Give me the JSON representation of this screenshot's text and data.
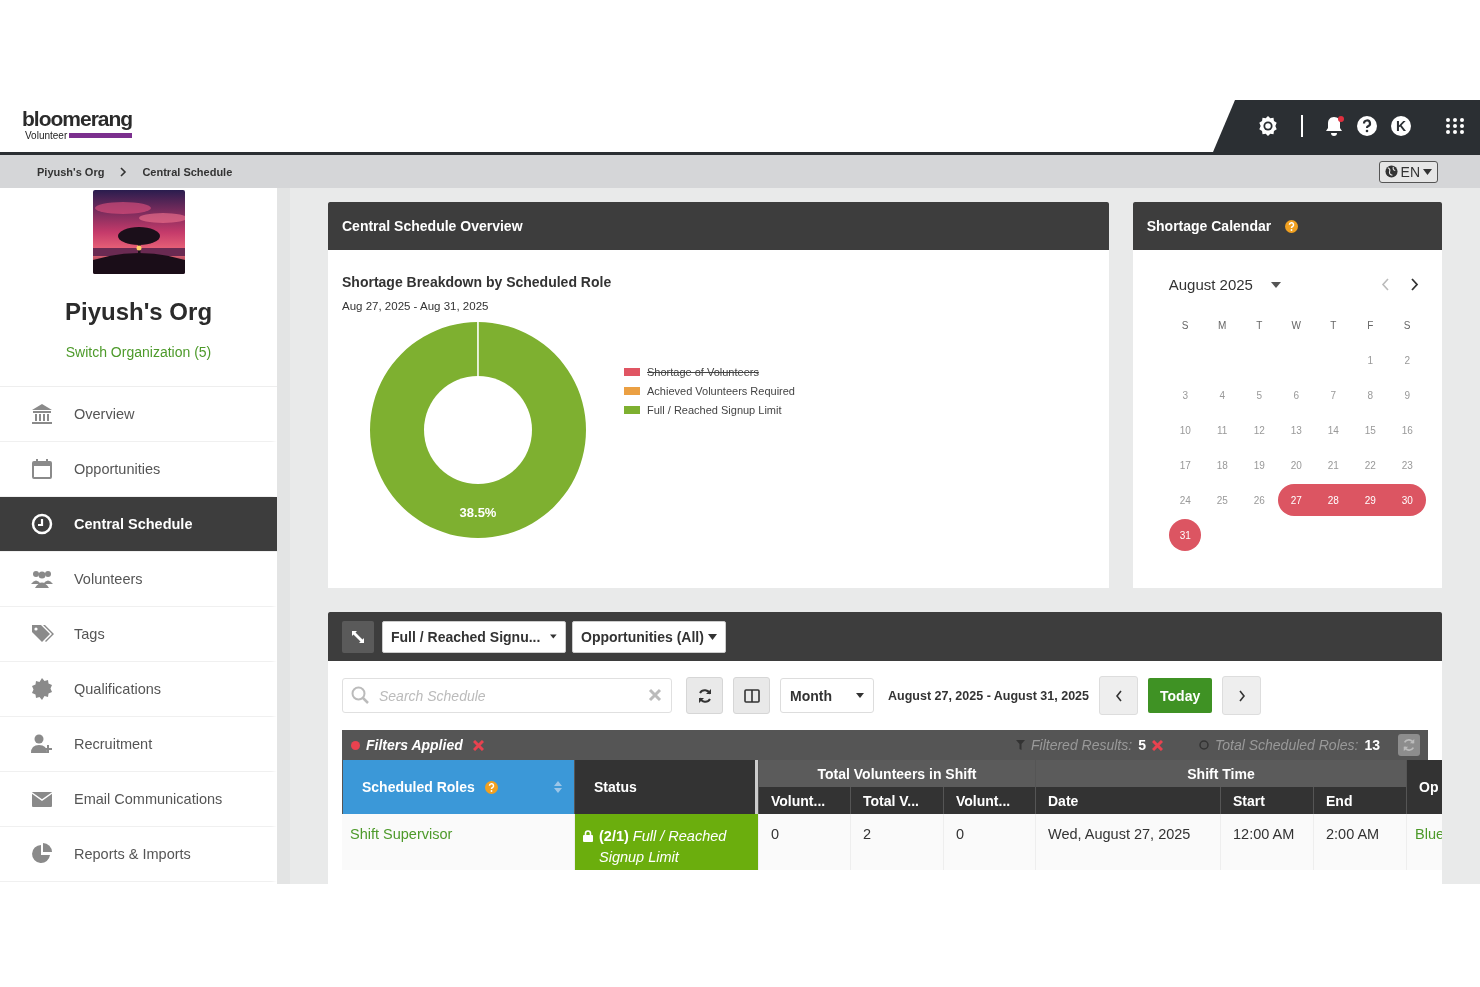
{
  "header": {
    "logo": "bloomerang",
    "logo_sub": "Volunteer",
    "avatar_letter": "K",
    "notification_dot": true
  },
  "breadcrumb": [
    "Piyush's Org",
    "Central Schedule"
  ],
  "language": "EN",
  "org": {
    "name": "Piyush's Org",
    "switch_link": "Switch Organization (5)"
  },
  "sidebar": {
    "items": [
      {
        "label": "Overview",
        "selected": false
      },
      {
        "label": "Opportunities",
        "selected": false
      },
      {
        "label": "Central Schedule",
        "selected": true
      },
      {
        "label": "Volunteers",
        "selected": false
      },
      {
        "label": "Tags",
        "selected": false
      },
      {
        "label": "Qualifications",
        "selected": false
      },
      {
        "label": "Recruitment",
        "selected": false
      },
      {
        "label": "Email Communications",
        "selected": false
      },
      {
        "label": "Reports & Imports",
        "selected": false
      }
    ]
  },
  "overview": {
    "title": "Central Schedule Overview",
    "legend": [
      {
        "hidden": true,
        "color": "#e05563"
      },
      {
        "hidden": false,
        "color": "#eba043"
      },
      {
        "hidden": false,
        "color": "#7eb030"
      }
    ],
    "chart_data": {
      "type": "donut",
      "title": "Shortage Breakdown by Scheduled Role",
      "subtitle": "Aug 27, 2025 - Aug 31, 2025",
      "categories": [
        "Shortage of Volunteers",
        "Achieved Volunteers Required",
        "Full / Reached Signup Limit"
      ],
      "values": [
        0,
        0,
        100
      ]
    },
    "slice_label": "38.5%"
  },
  "calendar": {
    "title": "Shortage Calendar",
    "month": "August 2025",
    "weekdays": [
      "S",
      "M",
      "T",
      "W",
      "T",
      "F",
      "S"
    ],
    "weeks": [
      [
        {
          "day": "1",
          "shortage": false
        },
        {
          "day": "2",
          "shortage": false
        }
      ],
      [
        {
          "day": "3",
          "shortage": false
        },
        {
          "day": "4",
          "shortage": false
        },
        {
          "day": "5",
          "shortage": false
        },
        {
          "day": "6",
          "shortage": false
        },
        {
          "day": "7",
          "shortage": false
        },
        {
          "day": "8",
          "shortage": false
        },
        {
          "day": "9",
          "shortage": false
        }
      ],
      [
        {
          "day": "10",
          "shortage": false
        },
        {
          "day": "11",
          "shortage": false
        },
        {
          "day": "12",
          "shortage": false
        },
        {
          "day": "13",
          "shortage": false
        },
        {
          "day": "14",
          "shortage": false
        },
        {
          "day": "15",
          "shortage": false
        },
        {
          "day": "16",
          "shortage": false
        }
      ],
      [
        {
          "day": "17",
          "shortage": false
        },
        {
          "day": "18",
          "shortage": false
        },
        {
          "day": "19",
          "shortage": false
        },
        {
          "day": "20",
          "shortage": false
        },
        {
          "day": "21",
          "shortage": false
        },
        {
          "day": "22",
          "shortage": false
        },
        {
          "day": "23",
          "shortage": false
        }
      ],
      [
        {
          "day": "24",
          "shortage": false
        },
        {
          "day": "25",
          "shortage": false
        },
        {
          "day": "26",
          "shortage": false
        },
        {
          "day": "27",
          "shortage": true
        },
        {
          "day": "28",
          "shortage": true
        },
        {
          "day": "29",
          "shortage": true
        },
        {
          "day": "30",
          "shortage": true
        }
      ],
      [
        {
          "day": "31",
          "shortage": true
        }
      ]
    ]
  },
  "schedule": {
    "filters": [
      "Full / Reached Signu...",
      "Opportunities (All)"
    ],
    "search": {
      "placeholder": "Search Schedule"
    },
    "view": "Month",
    "range": "August 27, 2025 - August 31, 2025",
    "today": "Today",
    "filter_bar": {
      "label": "Filters Applied",
      "results_label": "Filtered Results:",
      "results": "5",
      "total_label": "Total Scheduled Roles:",
      "total": "13"
    },
    "table": {
      "groups": [
        "Total Volunteers in Shift",
        "Shift Time"
      ],
      "columns": [
        {
          "label": "Scheduled Roles",
          "sorted": true
        },
        {
          "label": "Status",
          "sorted": false
        },
        {
          "label": "Volunt...",
          "sorted": false
        },
        {
          "label": "Total V...",
          "sorted": false
        },
        {
          "label": "Volunt...",
          "sorted": false
        },
        {
          "label": "Date",
          "sorted": false
        },
        {
          "label": "Start",
          "sorted": false
        },
        {
          "label": "End",
          "sorted": false
        },
        {
          "label": "Op",
          "sorted": false
        }
      ],
      "rows": [
        {
          "cells": [
            "Shift Supervisor",
            "**(2/1)** *Full / Reached Signup Limit*",
            "0",
            "2",
            "0",
            "Wed, August 27, 2025",
            "12:00 AM",
            "2:00 AM",
            "Blue"
          ]
        }
      ]
    }
  }
}
